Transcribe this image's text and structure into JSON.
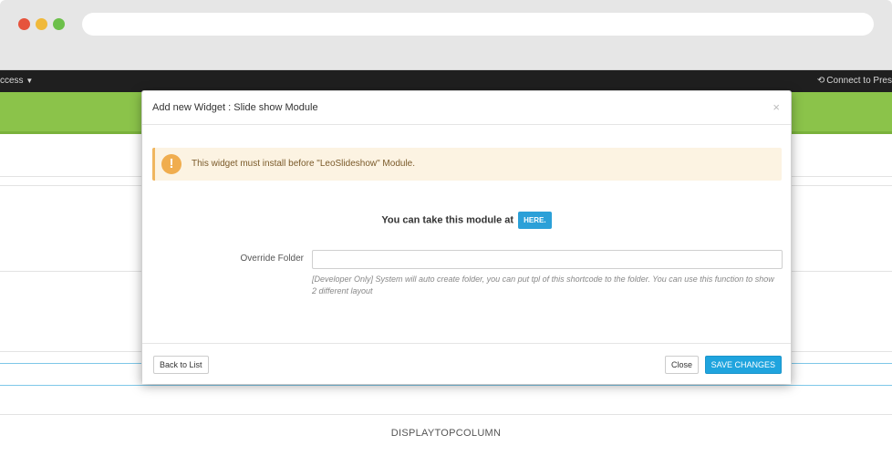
{
  "admin_bar": {
    "left_text": "ccess",
    "left_caret": "▼",
    "right_text": "Connect to Pres",
    "right_icon": "⟲"
  },
  "modal": {
    "title": "Add new Widget : Slide show Module",
    "close_glyph": "×",
    "alert": {
      "icon_glyph": "!",
      "text": "This widget must install before \"LeoSlideshow\" Module."
    },
    "take_module_text": "You can take this module at",
    "here_label": "HERE.",
    "override_folder": {
      "label": "Override Folder",
      "value": "",
      "help": "[Developer Only] System will auto create folder, you can put tpl of this shortcode to the folder. You can use this function to show 2 different layout"
    },
    "footer": {
      "back_label": "Back to List",
      "close_label": "Close",
      "save_label": "SAVE CHANGES"
    }
  },
  "bottom_label": "DISPLAYTOPCOLUMN",
  "colors": {
    "green_band": "#8bc34a",
    "accent_blue": "#1fa4de",
    "alert_bg": "#fcf3e2",
    "alert_icon": "#f0ad4e"
  }
}
